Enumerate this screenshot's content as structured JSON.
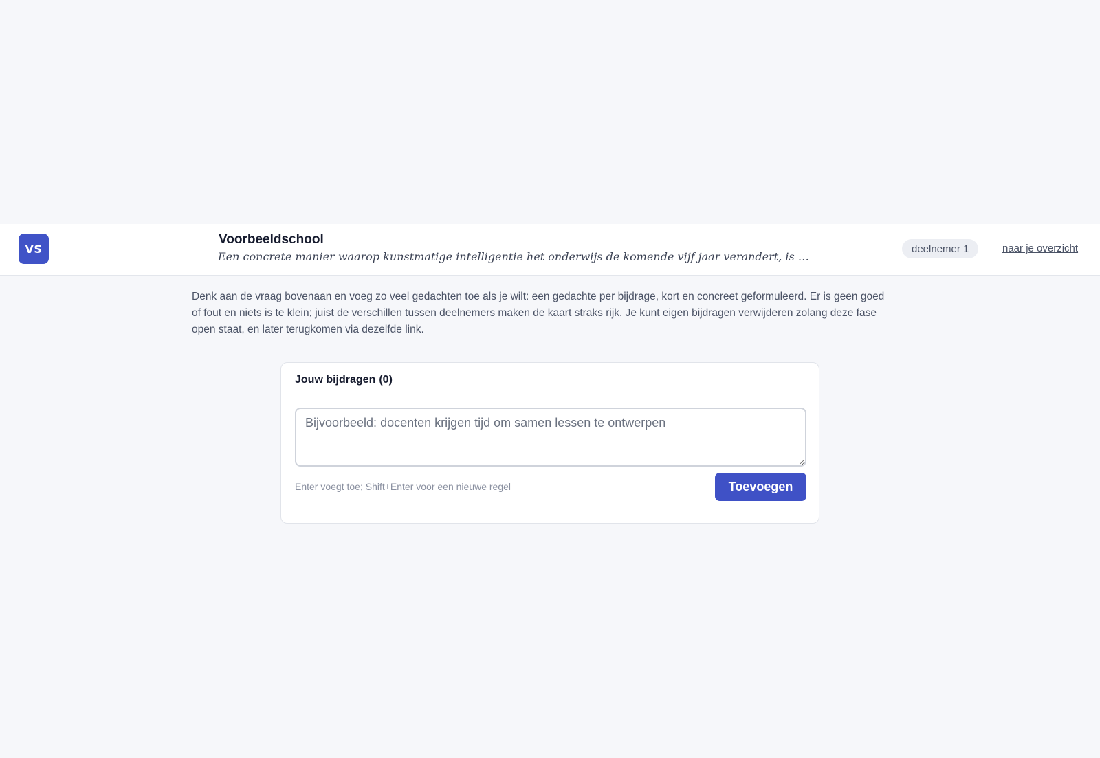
{
  "header": {
    "logo_initials": "VS",
    "school_name": "Voorbeeldschool",
    "question": "Een concrete manier waarop kunstmatige intelligentie het onderwijs de komende vijf jaar verandert, is …",
    "participant_badge": "deelnemer 1",
    "overview_link": "naar je overzicht"
  },
  "intro": "Denk aan de vraag bovenaan en voeg zo veel gedachten toe als je wilt: een gedachte per bijdrage, kort en concreet geformuleerd. Er is geen goed of fout en niets is te klein; juist de verschillen tussen deelnemers maken de kaart straks rijk. Je kunt eigen bijdragen verwijderen zolang deze fase open staat, en later terugkomen via dezelfde link.",
  "contributions": {
    "title": "Jouw bijdragen",
    "count": "(0)",
    "input_value": "",
    "input_placeholder": "Bijvoorbeeld: docenten krijgen tijd om samen lessen te ontwerpen",
    "hint": "Enter voegt toe; Shift+Enter voor een nieuwe regel",
    "add_button": "Toevoegen"
  },
  "colors": {
    "accent": "#3f51c6",
    "background": "#f6f7fa",
    "surface": "#ffffff",
    "badge_bg": "#eceef3"
  }
}
